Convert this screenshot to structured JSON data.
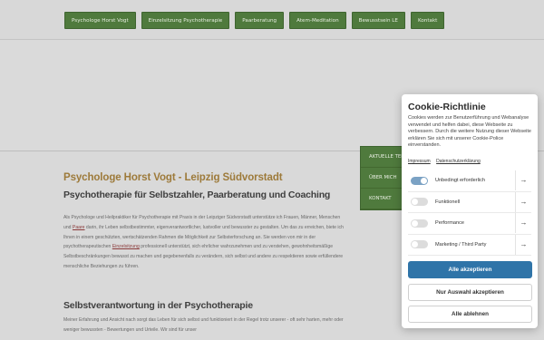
{
  "nav": {
    "items": [
      {
        "label": "Psychologe Horst Vogt"
      },
      {
        "label": "Einzelsitzung Psychotherapie"
      },
      {
        "label": "Paarberatung"
      },
      {
        "label": "Atem-Meditation"
      },
      {
        "label": "Bewusstsein LE"
      },
      {
        "label": "Kontakt"
      }
    ]
  },
  "main": {
    "title": "Psychologe Horst Vogt - Leipzig Südvorstadt",
    "subtitle": "Psychotherapie für Selbstzahler, Paarberatung und Coaching",
    "intro_a": "Als Psychologe und Heilpraktiker für Psychotherapie mit Praxis in der Leipziger Südvorstadt unterstütze ich Frauen, Männer, Menschen und ",
    "intro_link1": "Paare",
    "intro_b": " darin, ihr Leben selbstbestimmter, eigenverantwortlicher, lustvoller und bewusster zu gestalten. Um das zu erreichen, biete ich Ihnen in einem geschützten, wertschätzenden Rahmen die Möglichkeit zur Selbsterforschung an. Sie werden von mir in der psychotherapeutischen ",
    "intro_link2": "Einzelsitzung",
    "intro_c": " professionell unterstützt, sich ehrlicher wahrzunehmen und zu verstehen, gewohnheitsmäßige Selbstbeschränkungen bewusst zu machen und gegebenenfalls zu verändern, sich selbst und andere zu respektieren sowie erfüllendere menschliche Beziehungen zu führen.",
    "section_heading": "Selbstverantwortung in der Psychotherapie",
    "section_text": "Meiner Erfahrung und Ansicht nach sorgt das Leben für sich selbst und funktioniert in der Regel trotz unserer - oft sehr harten, mehr oder weniger bewussten - Bewertungen und Urteile. Wir sind für unser"
  },
  "sidenav": {
    "items": [
      {
        "label": "AKTUELLE TERMINE"
      },
      {
        "label": "ÜBER MICH"
      },
      {
        "label": "KONTAKT"
      }
    ]
  },
  "cookie": {
    "title": "Cookie-Richtlinie",
    "description": "Cookies werden zur Benutzerführung und Webanalyse verwendet und helfen dabei, diese Webseite zu verbessern. Durch die weitere Nutzung dieser Webseite erklären Sie sich mit unserer Cookie-Police einverstanden.",
    "link_impressum": "Impressum",
    "link_privacy": "Datenschutzerklärung",
    "categories": [
      {
        "label": "Unbedingt erforderlich",
        "enabled": true
      },
      {
        "label": "Funktionell",
        "enabled": false
      },
      {
        "label": "Performance",
        "enabled": false
      },
      {
        "label": "Marketing / Third Party",
        "enabled": false
      }
    ],
    "arrow_glyph": "→",
    "accept_all": "Alle akzeptieren",
    "accept_selection": "Nur Auswahl akzeptieren",
    "reject_all": "Alle ablehnen"
  },
  "colors": {
    "nav_green": "#4f7a3d",
    "title_gold": "#9d7a3a",
    "primary_blue": "#2f74a8",
    "toggle_on": "#7ba2c4"
  }
}
